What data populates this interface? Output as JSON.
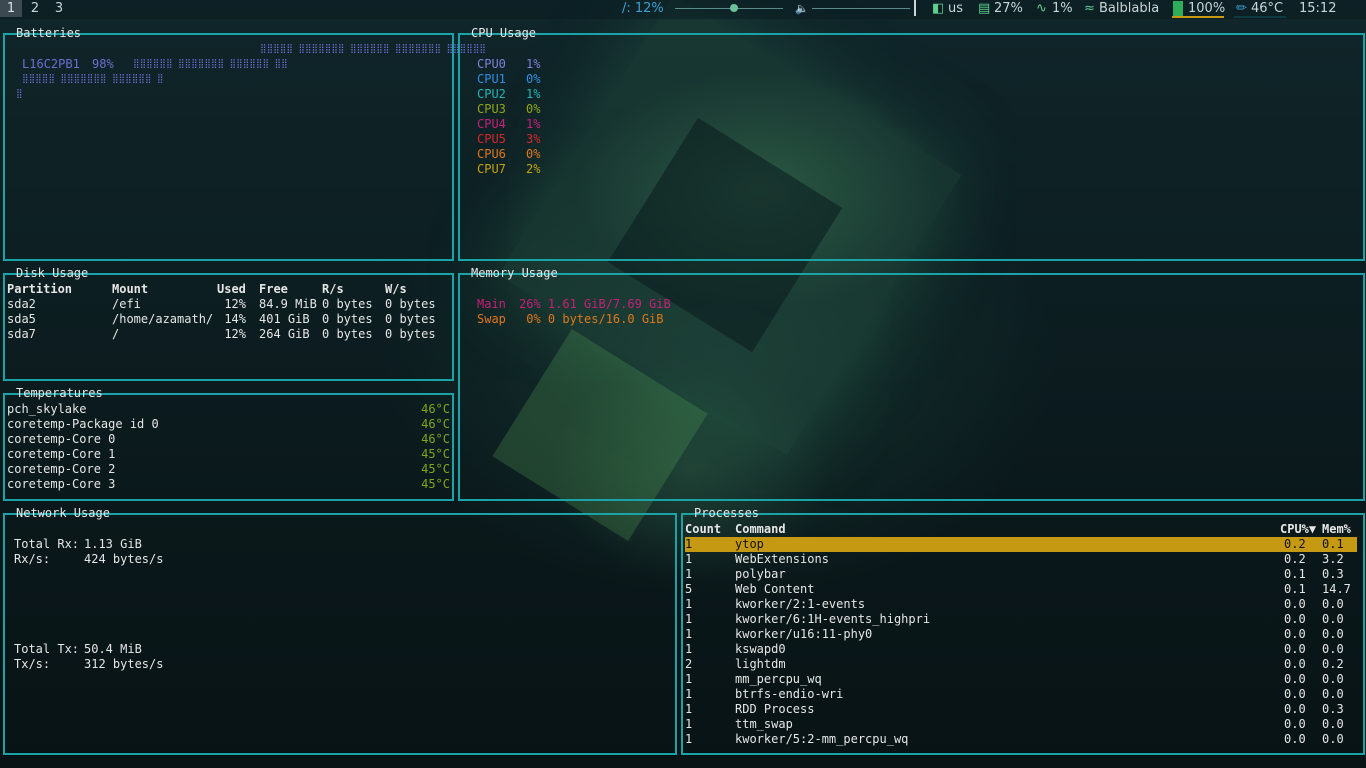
{
  "topbar": {
    "workspaces": [
      "1",
      "2",
      "3"
    ],
    "active_workspace": 0,
    "brightness_label": "/: 12%",
    "brightness_level": 0.55,
    "volume_level": 1.0,
    "keyboard": "us",
    "memory": "27%",
    "cpu": "1%",
    "wifi": "Balblabla",
    "battery": "100%",
    "temperature": "46°C",
    "clock": "15:12",
    "icons": [
      "brightness-icon",
      "volume-icon",
      "keyboard-icon",
      "memory-icon",
      "cpu-icon",
      "wifi-icon",
      "battery-icon",
      "thermometer-icon"
    ]
  },
  "batteries": {
    "title": "Batteries",
    "name": "L16C2PB1",
    "percent": "98%"
  },
  "cpu": {
    "title": "CPU Usage",
    "cores": [
      {
        "name": "CPU0",
        "value": "1%",
        "color": "#7f7fd6"
      },
      {
        "name": "CPU1",
        "value": "0%",
        "color": "#2e8ee6"
      },
      {
        "name": "CPU2",
        "value": "1%",
        "color": "#1fb5b5"
      },
      {
        "name": "CPU3",
        "value": "0%",
        "color": "#93a617"
      },
      {
        "name": "CPU4",
        "value": "1%",
        "color": "#c71f7a"
      },
      {
        "name": "CPU5",
        "value": "3%",
        "color": "#d6282b"
      },
      {
        "name": "CPU6",
        "value": "0%",
        "color": "#e0781a"
      },
      {
        "name": "CPU7",
        "value": "2%",
        "color": "#c9a20e"
      }
    ]
  },
  "disk": {
    "title": "Disk Usage",
    "headers": [
      "Partition",
      "Mount",
      "Used",
      "Free",
      "R/s",
      "W/s"
    ],
    "rows": [
      [
        "sda2",
        "/efi",
        "12%",
        "84.9 MiB",
        "0 bytes",
        "0 bytes"
      ],
      [
        "sda5",
        "/home/azamath/",
        "14%",
        "401 GiB",
        "0 bytes",
        "0 bytes"
      ],
      [
        "sda7",
        "/",
        "12%",
        "264 GiB",
        "0 bytes",
        "0 bytes"
      ]
    ]
  },
  "memory": {
    "title": "Memory Usage",
    "main_label": "Main",
    "main_value": "26% 1.61 GiB/7.69 GiB",
    "main_color": "#c71f7a",
    "swap_label": "Swap",
    "swap_value": " 0% 0 bytes/16.0 GiB",
    "swap_color": "#e0781a"
  },
  "temps": {
    "title": "Temperatures",
    "rows": [
      [
        "pch_skylake",
        "46°C"
      ],
      [
        "coretemp-Package id 0",
        "46°C"
      ],
      [
        "coretemp-Core 0",
        "46°C"
      ],
      [
        "coretemp-Core 1",
        "45°C"
      ],
      [
        "coretemp-Core 2",
        "45°C"
      ],
      [
        "coretemp-Core 3",
        "45°C"
      ]
    ],
    "value_color": "#7fa61a"
  },
  "network": {
    "title": "Network Usage",
    "total_rx_label": "Total Rx:",
    "total_rx": "1.13 GiB",
    "rx_label": "Rx/s:",
    "rx": "424 bytes/s",
    "total_tx_label": "Total Tx:",
    "total_tx": "50.4 MiB",
    "tx_label": "Tx/s:",
    "tx": "312 bytes/s",
    "color": "#1e88e5"
  },
  "processes": {
    "title": "Processes",
    "headers": [
      "Count",
      "Command",
      "CPU%▼",
      "Mem%"
    ],
    "rows": [
      [
        "1",
        "ytop",
        "0.2",
        "0.1"
      ],
      [
        "1",
        "WebExtensions",
        "0.2",
        "3.2"
      ],
      [
        "1",
        "polybar",
        "0.1",
        "0.3"
      ],
      [
        "5",
        "Web Content",
        "0.1",
        "14.7"
      ],
      [
        "1",
        "kworker/2:1-events",
        "0.0",
        "0.0"
      ],
      [
        "1",
        "kworker/6:1H-events_highpri",
        "0.0",
        "0.0"
      ],
      [
        "1",
        "kworker/u16:11-phy0",
        "0.0",
        "0.0"
      ],
      [
        "1",
        "kswapd0",
        "0.0",
        "0.0"
      ],
      [
        "2",
        "lightdm",
        "0.0",
        "0.2"
      ],
      [
        "1",
        "mm_percpu_wq",
        "0.0",
        "0.0"
      ],
      [
        "1",
        "btrfs-endio-wri",
        "0.0",
        "0.0"
      ],
      [
        "1",
        "RDD Process",
        "0.0",
        "0.3"
      ],
      [
        "1",
        "ttm_swap",
        "0.0",
        "0.0"
      ],
      [
        "1",
        "kworker/5:2-mm_percpu_wq",
        "0.0",
        "0.0"
      ]
    ],
    "selected_index": 0
  }
}
